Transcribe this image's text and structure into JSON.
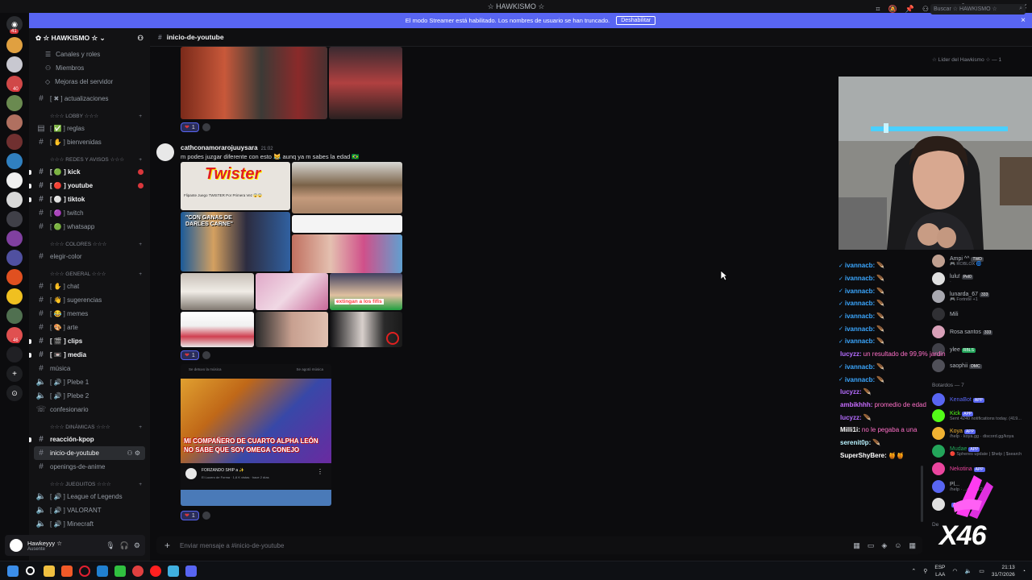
{
  "window": {
    "title": "☆ HAWKISMO ☆",
    "controls": [
      "—",
      "▢",
      "✕"
    ]
  },
  "banner": {
    "text": "El modo Streamer está habilitado. Los nombres de usuario se han truncado.",
    "button": "Deshabilitar"
  },
  "guild_badges": {
    "top": "41",
    "server1": "40",
    "server2": "46"
  },
  "server": {
    "name": "☆ HAWKISMO ☆"
  },
  "nav": [
    {
      "label": "Canales y roles",
      "icon": "list-icon"
    },
    {
      "label": "Miembros",
      "icon": "members-icon"
    },
    {
      "label": "Mejoras del servidor",
      "icon": "boost-icon"
    }
  ],
  "channels": {
    "actualizaciones": "[ ✖ ] actualizaciones",
    "cat_lobby": "☆☆☆ LOBBY ☆☆☆",
    "reglas": "[ ✅ ] reglas",
    "bienvenidas": "[ ✋ ] bienvenidas",
    "cat_redes": "☆☆☆ REDES Y AVISOS ☆☆☆",
    "kick": "[ 🟢 ] kick",
    "youtube": "[ 🔴 ] youtube",
    "tiktok": "[ ⚪ ] tiktok",
    "twitch": "[ 🟣 ] twitch",
    "whatsapp": "[ 🟢 ] whatsapp",
    "cat_colores": "☆☆☆ COLORES ☆☆☆",
    "elegir_color": "elegir-color",
    "cat_general": "☆☆☆ GENERAL ☆☆☆",
    "chat": "[ ✋ ] chat",
    "sugerencias": "[ 👋 ] sugerencias",
    "memes": "[ 😂 ] memes",
    "arte": "[ 🎨 ] arte",
    "clips": "[ 🎬 ] clips",
    "media": "[ 📼 ] media",
    "musica": "música",
    "plebe1": "[ 🔊 ] Plebe 1",
    "plebe2": "[ 🔊 ] Plebe 2",
    "confesionario": "confesionario",
    "cat_dinamicas": "☆☆☆ DINÁMICAS ☆☆☆",
    "reaccion_kpop": "reacción-kpop",
    "inicio_youtube": "inicio-de-youtube",
    "openings": "openings-de-anime",
    "cat_juegos": "☆☆☆ JUEGUITOS ☆☆☆",
    "lol": "[ 🔊 ] League of Legends",
    "valorant": "[ 🔊 ] VALORANT",
    "minecraft": "[ 🔊 ] Minecraft"
  },
  "user": {
    "name": "Hawkeyyy ☆",
    "status": "Ausente"
  },
  "header": {
    "channel": "inicio-de-youtube",
    "search_placeholder": "Buscar ☆ HAWKISMO ☆"
  },
  "messages": {
    "reaction_count": "1",
    "m2_author": "cathconamorarojuuysara",
    "m2_time": "21:02",
    "m2_text": "m podes juzgar diferente con esto 😹 aunq ya m sabes la edad 🇧🇷",
    "twister_title": "Twister",
    "twister_caption": "Flipante Juego TWISTER Por Primera Vez 😱😱",
    "ganas_text": "\"CON GANAS DE DARLES CARNE\"",
    "extingan_text": "extingan a los fifis",
    "card_top_left": "Se detuvo la música",
    "card_top_right": "Se agotó música",
    "card_banner": "MI COMPAÑERO DE CUARTO ALPHA LEÓN NO SABE QUE SOY OMEGA CONEJO",
    "card_video_title": "FORZANDO SHIP a ✨",
    "card_video_meta": "El Lucero de Forma · 1,6 K vistas · hace 2 días",
    "card_menu": "⋮"
  },
  "composer": {
    "placeholder": "Enviar mensaje a #inicio-de-youtube"
  },
  "stream_chat": [
    {
      "name": "ivannacb:",
      "text": "🪶",
      "color": "#3ba7ff"
    },
    {
      "name": "ivannacb:",
      "text": "🪶",
      "color": "#3ba7ff"
    },
    {
      "name": "ivannacb:",
      "text": "🪶",
      "color": "#3ba7ff"
    },
    {
      "name": "ivannacb:",
      "text": "🪶",
      "color": "#3ba7ff"
    },
    {
      "name": "ivannacb:",
      "text": "🪶",
      "color": "#3ba7ff"
    },
    {
      "name": "ivannacb:",
      "text": "🪶",
      "color": "#3ba7ff"
    },
    {
      "name": "ivannacb:",
      "text": "🪶",
      "color": "#3ba7ff"
    },
    {
      "name": "lucyzz:",
      "text": "un resultado de 99,9% jardin",
      "color": "#b56cff"
    },
    {
      "name": "ivannacb:",
      "text": "🪶",
      "color": "#3ba7ff"
    },
    {
      "name": "ivannacb:",
      "text": "🪶",
      "color": "#3ba7ff"
    },
    {
      "name": "lucyzz:",
      "text": "🪶",
      "color": "#b56cff"
    },
    {
      "name": "ambikhhh:",
      "text": "promedio de edad",
      "color": "#c86cff"
    },
    {
      "name": "lucyzz:",
      "text": "🪶",
      "color": "#b56cff"
    },
    {
      "name": "Milli1i:",
      "text": "no le pegaba a una",
      "color": "#ffffff"
    },
    {
      "name": "serenit0p:",
      "text": "🪶",
      "color": "#b9f3ff"
    },
    {
      "name": "SuperShyBere:",
      "text": "🍯🍯",
      "color": "#ffffff"
    }
  ],
  "members": {
    "cat_leader": "☆ Líder del Hawkismo ☆ — 1",
    "cat_bots": "Botardos — 7",
    "cat_other": "De",
    "list": [
      {
        "name": "Ampi ^^",
        "sub": "🎮 ROBLOX 🌀",
        "tag": "TWD",
        "color": "#b5bac1"
      },
      {
        "name": "lulu!",
        "sub": "·",
        "tag": "Pel0",
        "color": "#b5bac1"
      },
      {
        "name": "lunarda_67",
        "sub": "🎮 Fortnite +1",
        "tag": "333",
        "color": "#b5bac1"
      },
      {
        "name": "Mili",
        "sub": "",
        "tag": "",
        "color": "#b5bac1"
      },
      {
        "name": "Rosa santos",
        "sub": "",
        "tag": "333",
        "color": "#b5bac1"
      },
      {
        "name": "ylee",
        "sub": "",
        "tag": "RBLS",
        "color": "#b5bac1"
      },
      {
        "name": "saophii",
        "sub": "",
        "tag": "DMC",
        "color": "#b5bac1"
      }
    ],
    "bots": [
      {
        "name": "KenaBot",
        "sub": "",
        "tag": "APP",
        "color": "#5865f2"
      },
      {
        "name": "Kick",
        "sub": "Sent 4240 notifications today. (419...",
        "tag": "APP",
        "color": "#53fc18"
      },
      {
        "name": "Koya",
        "sub": "/help · koya.gg · discord.gg/koya",
        "tag": "APP",
        "color": "#f0b232"
      },
      {
        "name": "Mudae",
        "sub": "🔴 Spheres update | $help | $search",
        "tag": "APP",
        "color": "#23a55a"
      },
      {
        "name": "Nekotina",
        "sub": "·",
        "tag": "APP",
        "color": "#eb459e"
      },
      {
        "name": "Pl...",
        "sub": "/help · ...ord | v.2.1",
        "tag": "",
        "color": "#b5bac1"
      },
      {
        "name": "",
        "sub": "",
        "tag": "APP",
        "color": "#b5bac1"
      }
    ]
  },
  "overlay": {
    "multiplier": "X46"
  },
  "taskbar": {
    "lang": "ESP",
    "lang_sub": "LAA",
    "time": "21:13",
    "date": "31/7/2026"
  }
}
